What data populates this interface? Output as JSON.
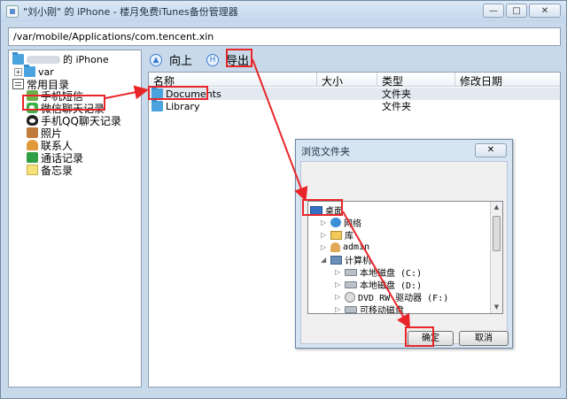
{
  "window": {
    "title_prefix": "\"刘小刚\" 的 iPhone - 楼月免费iTunes备份管理器",
    "minimize_glyph": "—",
    "maximize_glyph": "□",
    "close_glyph": "✕"
  },
  "path": "/var/mobile/Applications/com.tencent.xin",
  "tree": {
    "device_label": "的 iPhone",
    "var_label": "var",
    "common_label": "常用目录",
    "items": [
      {
        "label": "手机短信",
        "icon": "sms-icon"
      },
      {
        "label": "微信聊天记录",
        "icon": "wechat-icon"
      },
      {
        "label": "手机QQ聊天记录",
        "icon": "qq-icon"
      },
      {
        "label": "照片",
        "icon": "photo-icon"
      },
      {
        "label": "联系人",
        "icon": "contacts-icon"
      },
      {
        "label": "通话记录",
        "icon": "phone-icon"
      },
      {
        "label": "备忘录",
        "icon": "notes-icon"
      }
    ]
  },
  "toolbar": {
    "up_label": "向上",
    "export_label": "导出"
  },
  "listview": {
    "columns": [
      "名称",
      "大小",
      "类型",
      "修改日期"
    ],
    "rows": [
      {
        "name": "Documents",
        "type": "文件夹"
      },
      {
        "name": "Library",
        "type": "文件夹"
      }
    ]
  },
  "dialog": {
    "title": "浏览文件夹",
    "close_glyph": "✕",
    "tree": [
      {
        "label": "桌面",
        "icon": "desktop-icon"
      },
      {
        "label": "网络",
        "icon": "network-icon"
      },
      {
        "label": "库",
        "icon": "library-icon"
      },
      {
        "label": "admin",
        "icon": "user-icon"
      },
      {
        "label": "计算机",
        "icon": "computer-icon"
      },
      {
        "label": "本地磁盘 (C:)",
        "icon": "disk-icon"
      },
      {
        "label": "本地磁盘 (D:)",
        "icon": "disk-icon"
      },
      {
        "label": "DVD RW 驱动器 (F:)",
        "icon": "dvd-icon"
      },
      {
        "label": "可移动磁盘",
        "icon": "removable-disk-icon"
      }
    ],
    "ok_label": "确定",
    "cancel_label": "取消"
  },
  "colors": {
    "highlight": "#e8262a",
    "window_bg": "#c8daea"
  }
}
